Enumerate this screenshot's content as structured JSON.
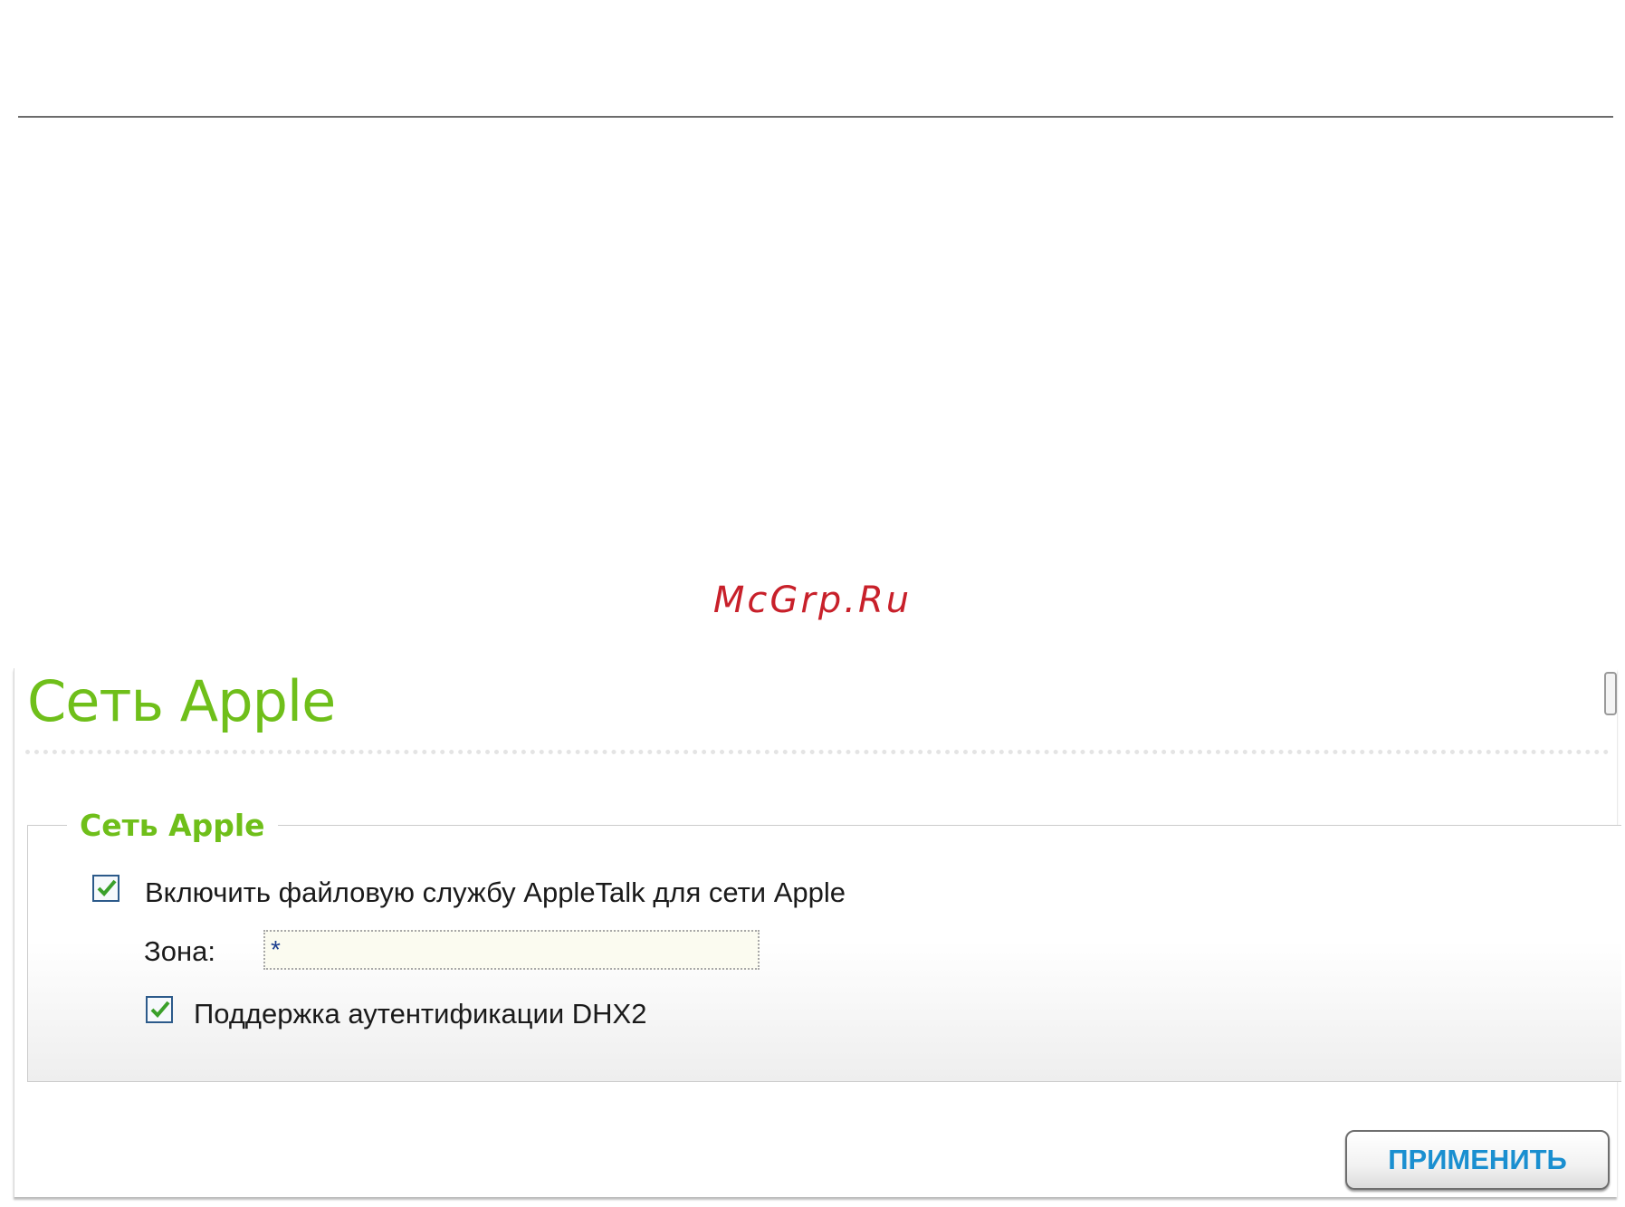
{
  "watermark": "McGrp.Ru",
  "page": {
    "title": "Сеть Apple"
  },
  "section": {
    "legend": "Сеть Apple",
    "enable_appletalk": {
      "label": "Включить файловую службу AppleTalk для сети Apple",
      "checked": true
    },
    "zone": {
      "label": "Зона:",
      "value": "*"
    },
    "dhx2": {
      "label": "Поддержка аутентификации DHX2",
      "checked": true
    }
  },
  "actions": {
    "apply_label": "ПРИМЕНИТЬ"
  },
  "colors": {
    "title_green": "#6fbf1a",
    "button_blue": "#1a8fd0",
    "watermark_red": "#c8202a",
    "checkbox_border": "#2c5a8a",
    "check_green": "#3aa02a"
  },
  "icons": {
    "checkmark": "check-icon"
  }
}
